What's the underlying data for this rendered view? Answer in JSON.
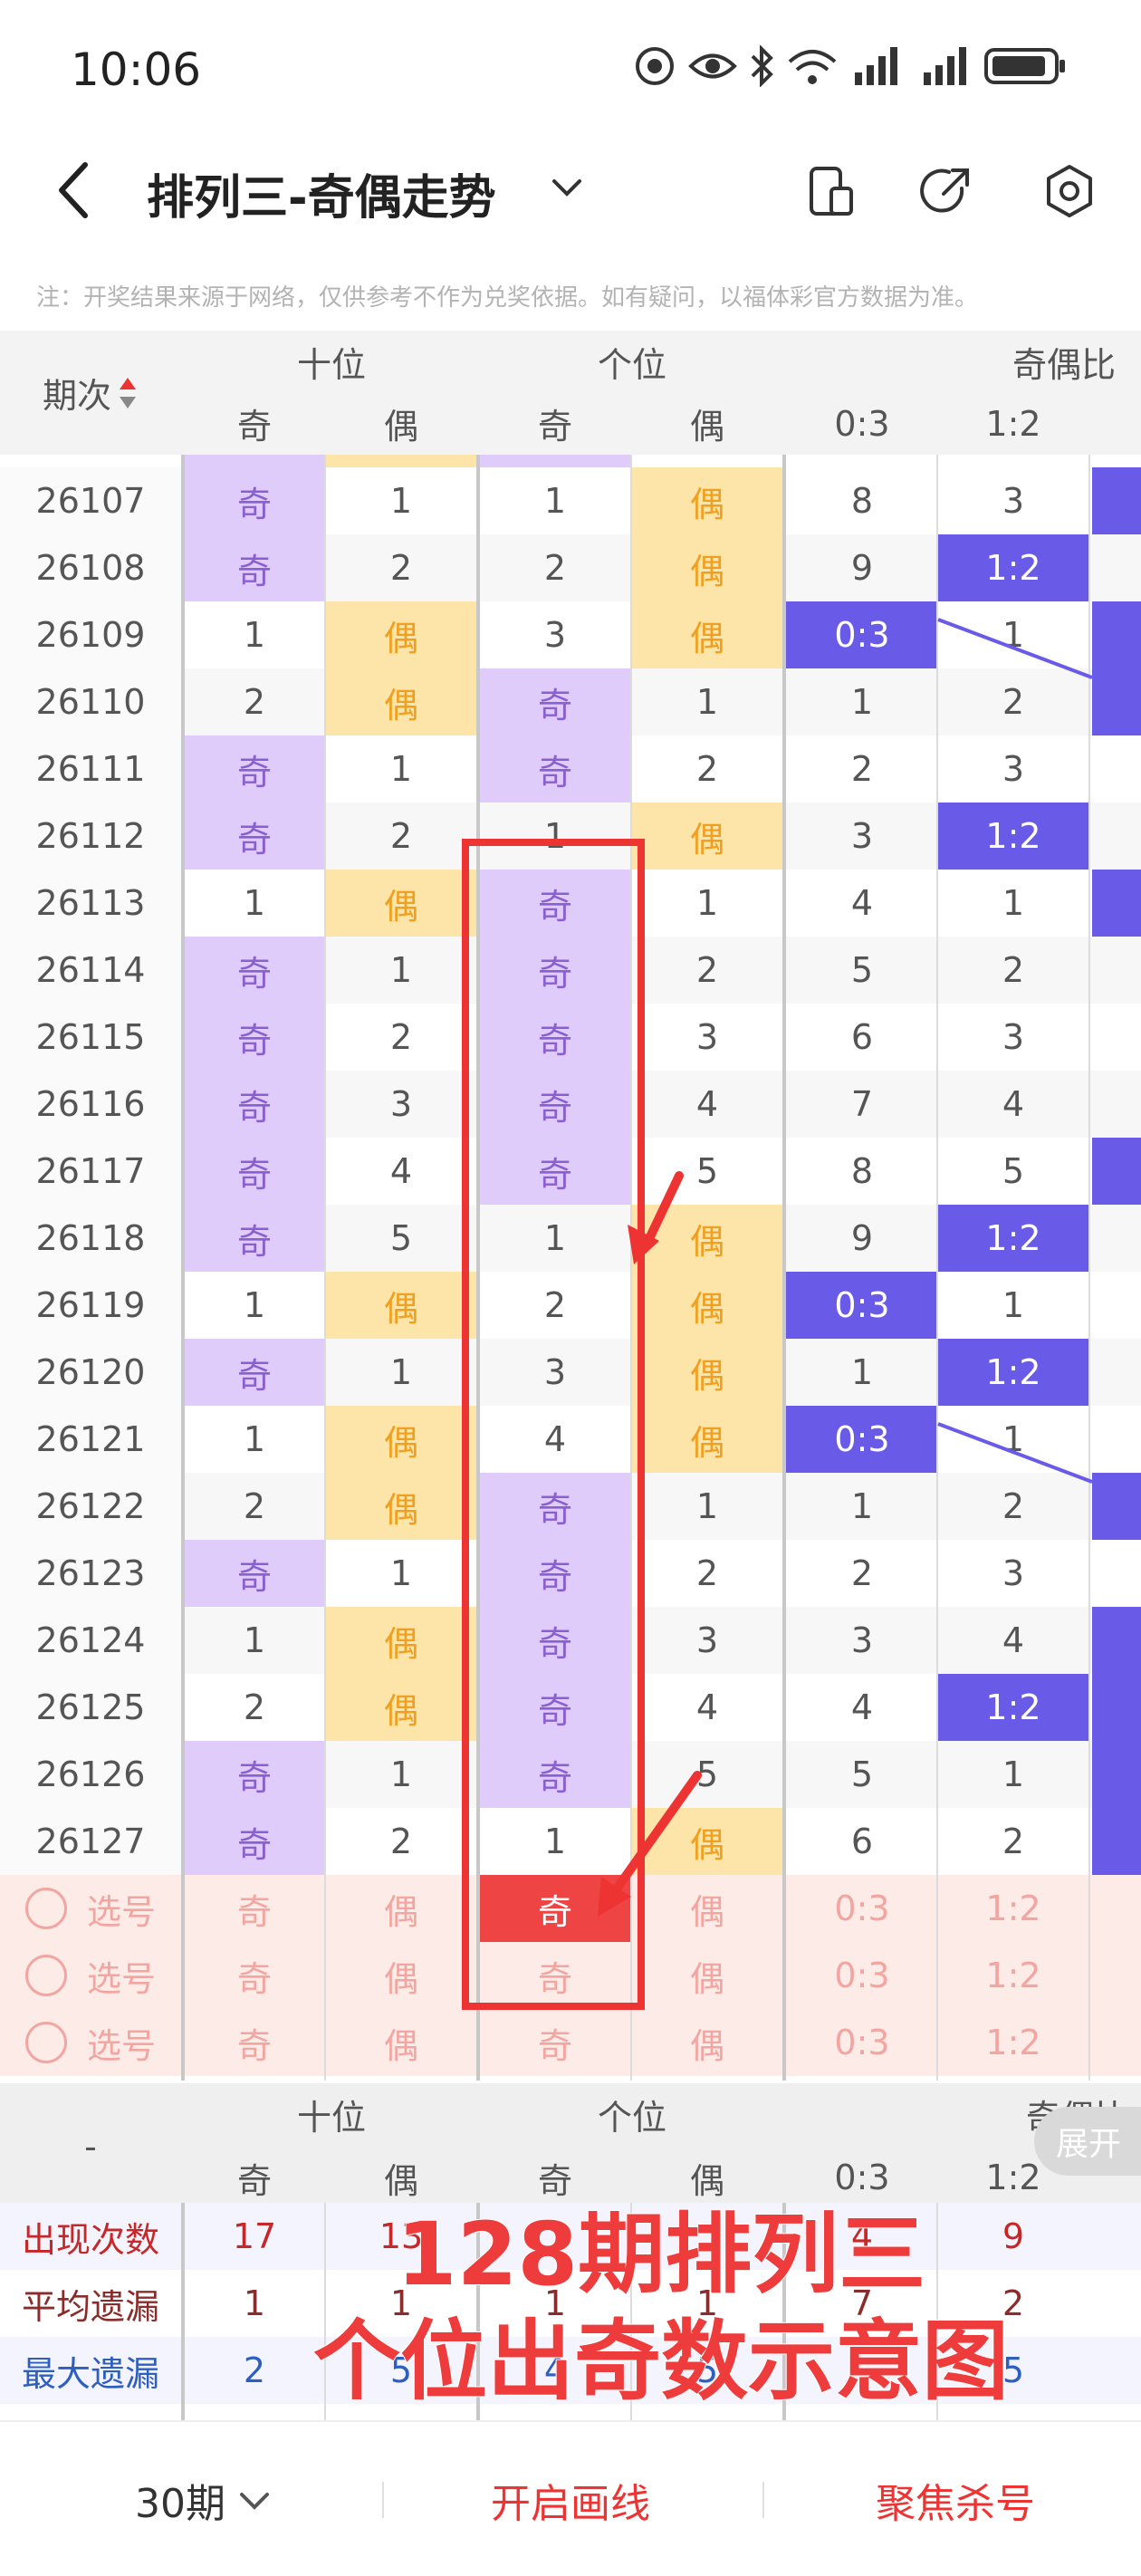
{
  "status_bar": {
    "time": "10:06"
  },
  "header": {
    "title": "排列三-奇偶走势"
  },
  "notice": "注：开奖结果来源于网络，仅供参考不作为兑奖依据。如有疑问，以福体彩官方数据为准。",
  "table_header": {
    "period_label": "期次",
    "groups": [
      "十位",
      "个位",
      "奇偶比"
    ],
    "sub": [
      "奇",
      "偶",
      "奇",
      "偶",
      "0:3",
      "1:2"
    ]
  },
  "rows": [
    {
      "period": "26107",
      "cells": [
        "奇",
        "1",
        "1",
        "偶",
        "8",
        "3"
      ]
    },
    {
      "period": "26108",
      "cells": [
        "奇",
        "2",
        "2",
        "偶",
        "9",
        "1:2"
      ]
    },
    {
      "period": "26109",
      "cells": [
        "1",
        "偶",
        "3",
        "偶",
        "0:3",
        "1"
      ]
    },
    {
      "period": "26110",
      "cells": [
        "2",
        "偶",
        "奇",
        "1",
        "1",
        "2"
      ]
    },
    {
      "period": "26111",
      "cells": [
        "奇",
        "1",
        "奇",
        "2",
        "2",
        "3"
      ]
    },
    {
      "period": "26112",
      "cells": [
        "奇",
        "2",
        "1",
        "偶",
        "3",
        "1:2"
      ]
    },
    {
      "period": "26113",
      "cells": [
        "1",
        "偶",
        "奇",
        "1",
        "4",
        "1"
      ]
    },
    {
      "period": "26114",
      "cells": [
        "奇",
        "1",
        "奇",
        "2",
        "5",
        "2"
      ]
    },
    {
      "period": "26115",
      "cells": [
        "奇",
        "2",
        "奇",
        "3",
        "6",
        "3"
      ]
    },
    {
      "period": "26116",
      "cells": [
        "奇",
        "3",
        "奇",
        "4",
        "7",
        "4"
      ]
    },
    {
      "period": "26117",
      "cells": [
        "奇",
        "4",
        "奇",
        "5",
        "8",
        "5"
      ]
    },
    {
      "period": "26118",
      "cells": [
        "奇",
        "5",
        "1",
        "偶",
        "9",
        "1:2"
      ]
    },
    {
      "period": "26119",
      "cells": [
        "1",
        "偶",
        "2",
        "偶",
        "0:3",
        "1"
      ]
    },
    {
      "period": "26120",
      "cells": [
        "奇",
        "1",
        "3",
        "偶",
        "1",
        "1:2"
      ]
    },
    {
      "period": "26121",
      "cells": [
        "1",
        "偶",
        "4",
        "偶",
        "0:3",
        "1"
      ]
    },
    {
      "period": "26122",
      "cells": [
        "2",
        "偶",
        "奇",
        "1",
        "1",
        "2"
      ]
    },
    {
      "period": "26123",
      "cells": [
        "奇",
        "1",
        "奇",
        "2",
        "2",
        "3"
      ]
    },
    {
      "period": "26124",
      "cells": [
        "1",
        "偶",
        "奇",
        "3",
        "3",
        "4"
      ]
    },
    {
      "period": "26125",
      "cells": [
        "2",
        "偶",
        "奇",
        "4",
        "4",
        "1:2"
      ]
    },
    {
      "period": "26126",
      "cells": [
        "奇",
        "1",
        "奇",
        "5",
        "5",
        "1"
      ]
    },
    {
      "period": "26127",
      "cells": [
        "奇",
        "2",
        "1",
        "偶",
        "6",
        "2"
      ]
    }
  ],
  "pick_rows": [
    {
      "label": "选号",
      "cells": [
        "奇",
        "偶",
        "奇",
        "偶",
        "0:3",
        "1:2"
      ],
      "selected": true
    },
    {
      "label": "选号",
      "cells": [
        "奇",
        "偶",
        "奇",
        "偶",
        "0:3",
        "1:2"
      ],
      "selected": false
    },
    {
      "label": "选号",
      "cells": [
        "奇",
        "偶",
        "奇",
        "偶",
        "0:3",
        "1:2"
      ],
      "selected": false
    }
  ],
  "summary_header": {
    "dash": "-",
    "groups": [
      "十位",
      "个位",
      "奇偶比"
    ],
    "sub": [
      "奇",
      "偶",
      "奇",
      "偶",
      "0:3",
      "1:2"
    ]
  },
  "summary_rows": [
    {
      "label": "出现次数",
      "cells": [
        "17",
        "13",
        "",
        "",
        "4",
        "9"
      ]
    },
    {
      "label": "平均遗漏",
      "cells": [
        "1",
        "1",
        "1",
        "1",
        "7",
        "2"
      ]
    },
    {
      "label": "最大遗漏",
      "cells": [
        "2",
        "5",
        "4",
        "5",
        "",
        "5"
      ]
    }
  ],
  "expand_label": "展开",
  "annotation": [
    "128期排列三",
    "个位出奇数示意图"
  ],
  "bottom_bar": {
    "periods": "30期",
    "draw_line": "开启画线",
    "focus_kill": "聚焦杀号"
  },
  "colors": {
    "odd_cell": "#e0ccfb",
    "odd_text": "#8a5fd0",
    "even_cell": "#fde4a8",
    "even_text": "#f0a020",
    "ratio_cell": "#6a5ae8",
    "pick_bg": "#fcebe6",
    "pick_text": "#f3a6a1",
    "selected": "#ee4444",
    "annotation": "#ee3b3b"
  }
}
